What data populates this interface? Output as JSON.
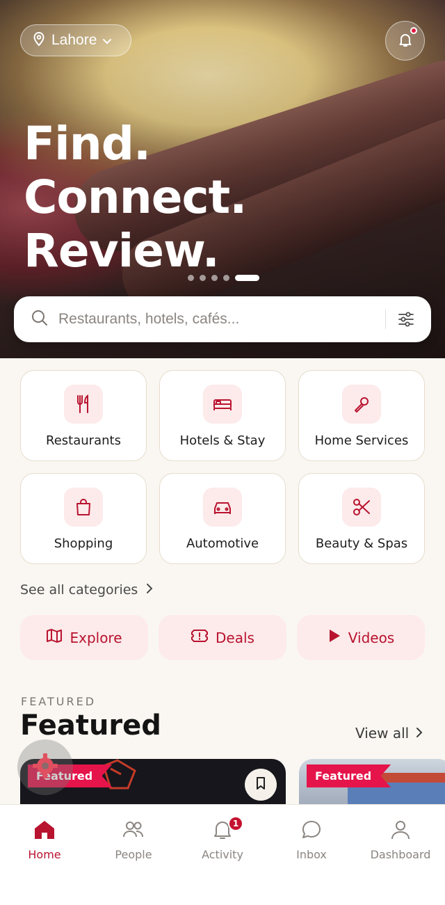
{
  "header": {
    "location": "Lahore",
    "headline": [
      "Find.",
      "Connect.",
      "Review."
    ],
    "carousel_dots": 5,
    "carousel_active_index": 4
  },
  "search": {
    "placeholder": "Restaurants, hotels, cafés..."
  },
  "categories": [
    {
      "label": "Restaurants",
      "icon": "fork-knife-icon"
    },
    {
      "label": "Hotels & Stay",
      "icon": "bed-icon"
    },
    {
      "label": "Home Services",
      "icon": "wrench-icon"
    },
    {
      "label": "Shopping",
      "icon": "shopping-bag-icon"
    },
    {
      "label": "Automotive",
      "icon": "car-icon"
    },
    {
      "label": "Beauty & Spas",
      "icon": "scissors-icon"
    }
  ],
  "see_all_categories": "See all categories",
  "quick_links": [
    {
      "label": "Explore",
      "icon": "map-icon"
    },
    {
      "label": "Deals",
      "icon": "ticket-icon"
    },
    {
      "label": "Videos",
      "icon": "play-icon"
    }
  ],
  "featured": {
    "eyebrow": "FEATURED",
    "title": "Featured",
    "view_all": "View all",
    "cards": [
      {
        "badge": "Featured"
      },
      {
        "badge": "Featured"
      }
    ]
  },
  "tabbar": {
    "items": [
      {
        "label": "Home",
        "icon": "home-icon",
        "active": true
      },
      {
        "label": "People",
        "icon": "people-icon",
        "active": false
      },
      {
        "label": "Activity",
        "icon": "bell-icon",
        "active": false,
        "badge": "1"
      },
      {
        "label": "Inbox",
        "icon": "chat-bubble-icon",
        "active": false
      },
      {
        "label": "Dashboard",
        "icon": "user-icon",
        "active": false
      }
    ]
  },
  "colors": {
    "accent": "#b8132f",
    "accent_soft": "#fdeaea",
    "ribbon": "#e5144a",
    "background": "#faf7f2"
  }
}
